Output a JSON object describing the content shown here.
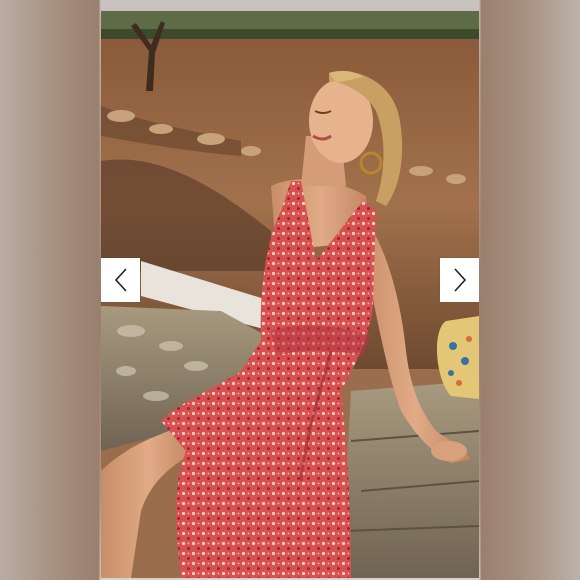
{
  "gallery": {
    "photo_alt": "",
    "prev_icon": "chevron-left-icon",
    "next_icon": "chevron-right-icon",
    "colors": {
      "dress": "#d64b4f",
      "button": "#ffffff",
      "arrow": "#222222"
    }
  }
}
